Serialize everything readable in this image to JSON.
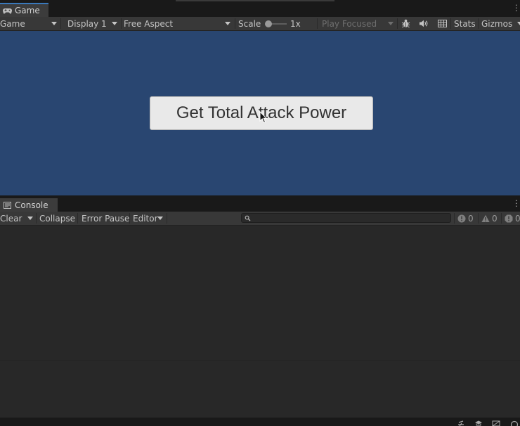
{
  "game_window": {
    "tab_label": "Game",
    "toolbar": {
      "view_select": "Game",
      "display_select": "Display 1",
      "aspect_select": "Free Aspect",
      "scale_label": "Scale",
      "scale_value": "1x",
      "play_mode_select": "Play Focused",
      "stats_label": "Stats",
      "gizmos_label": "Gizmos"
    },
    "viewport": {
      "background_color": "#294671",
      "button_label": "Get Total Attack Power"
    }
  },
  "console_window": {
    "tab_label": "Console",
    "toolbar": {
      "clear_label": "Clear",
      "collapse_label": "Collapse",
      "error_pause_label": "Error Pause",
      "editor_label": "Editor",
      "search_placeholder": "",
      "info_count": "0",
      "warning_count": "0",
      "error_count": "0"
    }
  },
  "icons": {
    "game_tab": "gamepad-icon",
    "console_tab": "console-icon",
    "bug": "bug-icon",
    "audio": "speaker-icon",
    "grid": "grid-icon",
    "search": "search-icon"
  }
}
